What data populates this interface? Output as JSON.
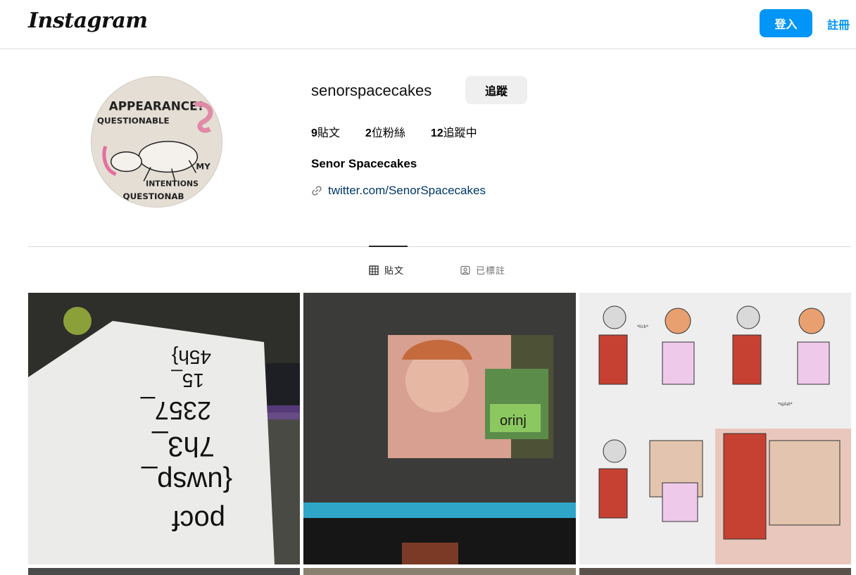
{
  "header": {
    "logo": "Instagram",
    "login_label": "登入",
    "signup_label": "註冊"
  },
  "profile": {
    "username": "senorspacecakes",
    "follow_label": "追蹤",
    "stats": {
      "posts_count": "9",
      "posts_label": "貼文",
      "followers_prefix": "2",
      "followers_label": "位粉絲",
      "following_count": "12",
      "following_label": "追蹤中"
    },
    "full_name": "Senor Spacecakes",
    "link": "twitter.com/SenorSpacecakes",
    "avatar_text": {
      "line1": "APPEARANCE?",
      "line2": "QUESTIONABLE",
      "line3": "MY",
      "line4": "INTENTIONS",
      "line5": "QUESTIONAB"
    }
  },
  "tabs": {
    "posts_label": "貼文",
    "tagged_label": "已標註"
  },
  "posts": {
    "p1_text": [
      "pocf",
      "{uwsp_",
      "7h3_",
      "2357_",
      "15_",
      "45h}"
    ],
    "p2_label": "orinj",
    "p3_labels": {
      "lick": "*lick*",
      "splat": "*splat*"
    }
  },
  "colors": {
    "accent": "#0095f6",
    "link": "#00376b"
  }
}
